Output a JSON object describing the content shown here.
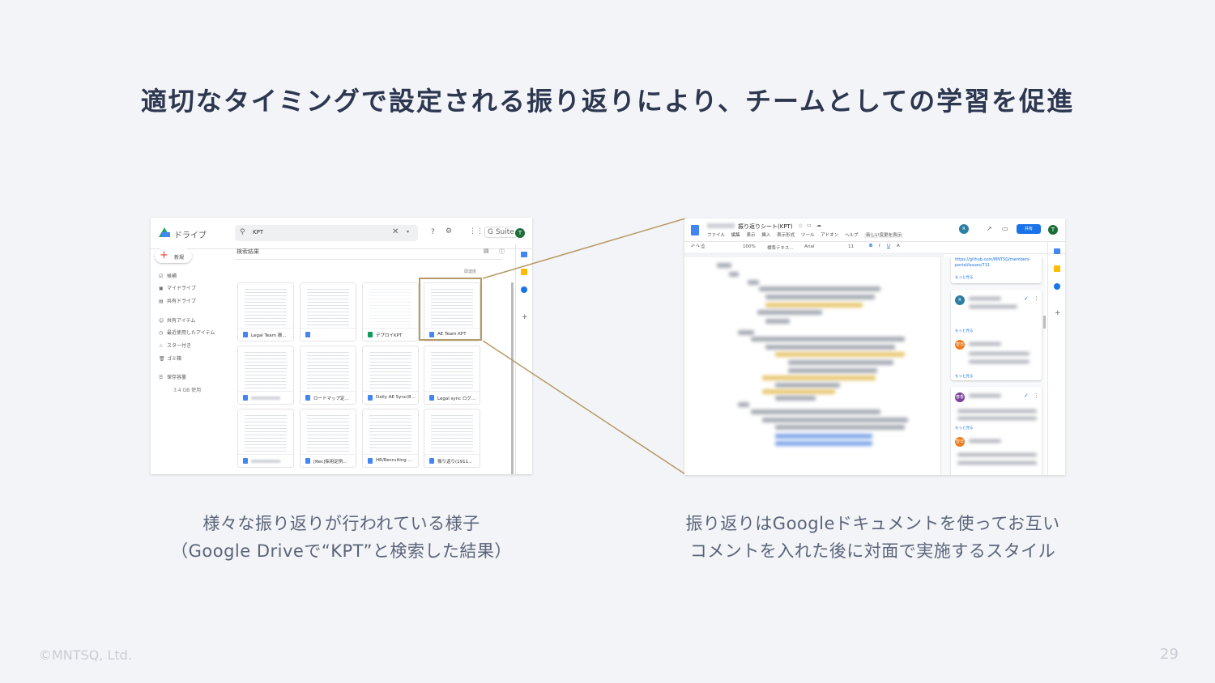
{
  "slide": {
    "title": "適切なタイミングで設定される振り返りにより、チームとしての学習を促進",
    "caption_left_1": "様々な振り返りが行われている様子",
    "caption_left_2": "（Google Driveで“KPT”と検索した結果）",
    "caption_right_1": "振り返りはGoogleドキュメントを使ってお互い",
    "caption_right_2": "コメントを入れた後に対面で実施するスタイル",
    "copyright": "©MNTSQ, Ltd.",
    "page_number": "29",
    "accent_color": "#b59a66"
  },
  "drive": {
    "app_title": "ドライブ",
    "search_value": "KPT",
    "gsuite_label": "G Suite",
    "avatar_letter": "T",
    "new_button": "新規",
    "nav": [
      "候補",
      "マイドライブ",
      "共有ドライブ",
      "共有アイテム",
      "最近使用したアイテム",
      "スター付き",
      "ゴミ箱",
      "保存容量"
    ],
    "storage_used": "3.4 GB 使用",
    "results_header": "検索結果",
    "sort_label": "関連度",
    "files": [
      {
        "name": "Legal Team 振...",
        "type": "doc"
      },
      {
        "name": "",
        "type": "doc"
      },
      {
        "name": "デプロイKPT",
        "type": "sheet"
      },
      {
        "name": "AE Team KPT",
        "type": "doc"
      },
      {
        "name": "",
        "type": "doc"
      },
      {
        "name": "ロードマップ定...",
        "type": "doc"
      },
      {
        "name": "Daily AE Sync(8...",
        "type": "doc"
      },
      {
        "name": "Legal sync ログ...",
        "type": "doc"
      },
      {
        "name": "",
        "type": "doc"
      },
      {
        "name": "[Rec]採用定例...",
        "type": "doc"
      },
      {
        "name": "HR/Recruiting ...",
        "type": "doc"
      },
      {
        "name": "振り返り(1911...",
        "type": "doc"
      }
    ]
  },
  "docs": {
    "doc_title": "振り返りシート(KPT)",
    "menus": [
      "ファイル",
      "編集",
      "表示",
      "挿入",
      "表示形式",
      "ツール",
      "アドオン",
      "ヘルプ"
    ],
    "last_edit": "新しい変更を表示",
    "share_label": "共有",
    "avatar_letter": "T",
    "toolbar_zoom": "100%",
    "toolbar_style": "標準テキス...",
    "toolbar_font": "Arial",
    "toolbar_size": "11",
    "comment_link": "https://github.com/MNTSQ/members-portal/issues/711",
    "more_label": "もっと見る",
    "commenters": [
      "R",
      "智日",
      "春香",
      "智日"
    ]
  }
}
